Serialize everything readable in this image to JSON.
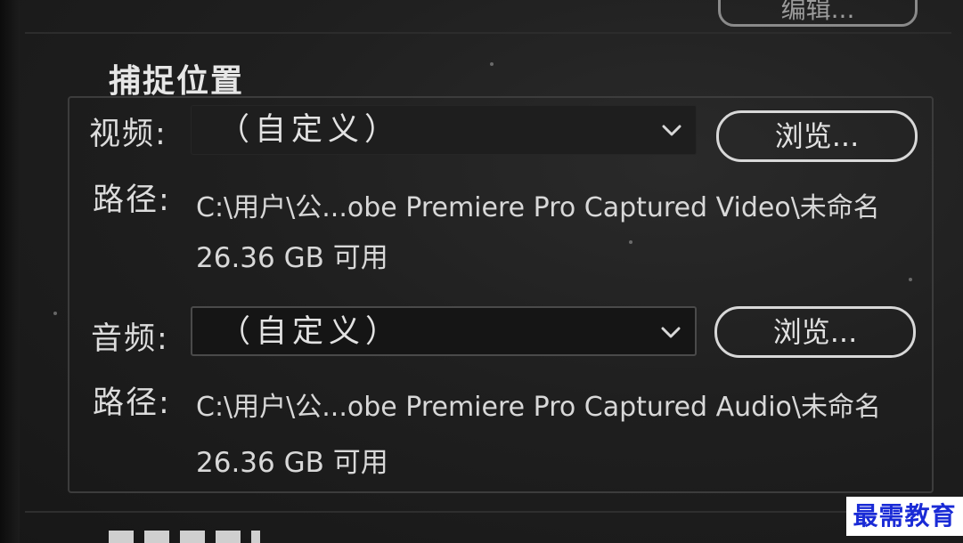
{
  "top_button": {
    "label": "编辑..."
  },
  "capture_location": {
    "title": "捕捉位置",
    "video": {
      "label": "视频:",
      "selected": "（自定义）",
      "browse_label": "浏览...",
      "path_label": "路径:",
      "path_value": "C:\\用户\\公...obe Premiere Pro Captured Video\\未命名",
      "free_space": "26.36 GB 可用"
    },
    "audio": {
      "label": "音频:",
      "selected": "（自定义）",
      "browse_label": "浏览...",
      "path_label": "路径:",
      "path_value": "C:\\用户\\公...obe Premiere Pro Captured Audio\\未命名",
      "free_space": "26.36 GB 可用"
    }
  },
  "watermark": {
    "text": "最需教育"
  },
  "colors": {
    "background": "#1f1f1f",
    "text": "#d8d8d8",
    "button_border": "#d8d8d8",
    "watermark_text": "#1a2bd6"
  },
  "icons": {
    "dropdown": "chevron-down-icon"
  }
}
